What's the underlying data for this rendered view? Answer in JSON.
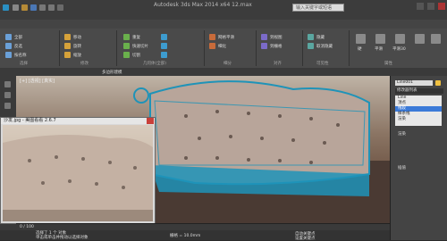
{
  "titlebar": {
    "title": "Autodesk 3ds Max  2014 x64    12.max",
    "search_placeholder": "输入关键字或短语"
  },
  "ribbon": {
    "groups": [
      {
        "label": "选择",
        "items": [
          "全部",
          "反选",
          "按名称"
        ]
      },
      {
        "label": "修改",
        "items": [
          "移动",
          "旋转",
          "缩放"
        ]
      },
      {
        "label": "几何体(全部)",
        "items": [
          "重复",
          "快速切片",
          "切割"
        ]
      },
      {
        "label": "细分",
        "items": [
          "网格平滑",
          "细化"
        ]
      },
      {
        "label": "对齐",
        "items": [
          "到视图",
          "到栅格"
        ]
      },
      {
        "label": "可见性",
        "items": [
          "隐藏",
          "取消隐藏"
        ]
      },
      {
        "label": "属性",
        "items": [
          "硬",
          "平滑",
          "平滑30"
        ]
      }
    ],
    "subbar_label": "多边形建模"
  },
  "viewport": {
    "label": "[+] [透视] [真实]"
  },
  "command_panel": {
    "object_name": "Line001",
    "modifier_list": "修改器列表",
    "stack": [
      {
        "label": "Line",
        "selected": false
      },
      {
        "label": "顶点",
        "selected": false
      },
      {
        "label": "线段",
        "selected": true
      },
      {
        "label": "样条线",
        "selected": false
      },
      {
        "label": "渲染",
        "selected": false
      }
    ],
    "rollout_title": "渲染",
    "interpolation": "插值"
  },
  "image_window": {
    "title": "沙发.jpg - 美图看看 2.6.7"
  },
  "timeline": {
    "frame_label": "0 / 100"
  },
  "status": {
    "line1": "选择了 1 个 对象",
    "line2": "单击或单击并拖动以选择对象",
    "grid_label": "栅格 = 10.0mm",
    "autokey": "自动关键点",
    "setkey": "设置关键点"
  },
  "colors": {
    "viewport_bg": "#8a7463",
    "mesh_blue": "#1f93b8",
    "selection_blue": "#3b7ad8",
    "ui_dark": "#444444"
  }
}
